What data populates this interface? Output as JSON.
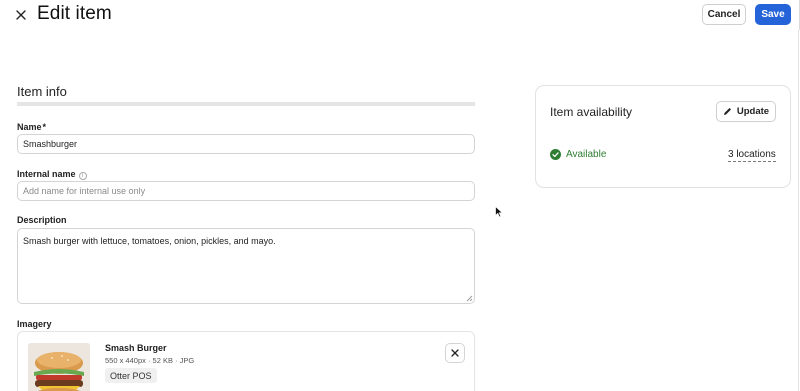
{
  "header": {
    "title": "Edit item",
    "cancel_label": "Cancel",
    "save_label": "Save"
  },
  "item_info": {
    "section_title": "Item info",
    "name": {
      "label": "Name",
      "required_mark": "*",
      "value": "Smashburger"
    },
    "internal_name": {
      "label": "Internal name",
      "value": "",
      "placeholder": "Add name for internal use only"
    },
    "description": {
      "label": "Description",
      "value": "Smash burger with lettuce, tomatoes, onion, pickles, and mayo."
    },
    "imagery": {
      "label": "Imagery",
      "image": {
        "name": "Smash Burger",
        "meta": "550 x 440px · 52 KB · JPG",
        "source_badge": "Otter POS"
      }
    }
  },
  "availability": {
    "title": "Item availability",
    "update_label": "Update",
    "status": "Available",
    "locations": "3 locations"
  },
  "colors": {
    "primary": "#2563d9",
    "success": "#2e7d32",
    "border": "#d4d4d4"
  },
  "icons": [
    "close-icon",
    "info-icon",
    "pencil-icon",
    "check-circle-icon",
    "remove-icon",
    "cursor-icon"
  ]
}
